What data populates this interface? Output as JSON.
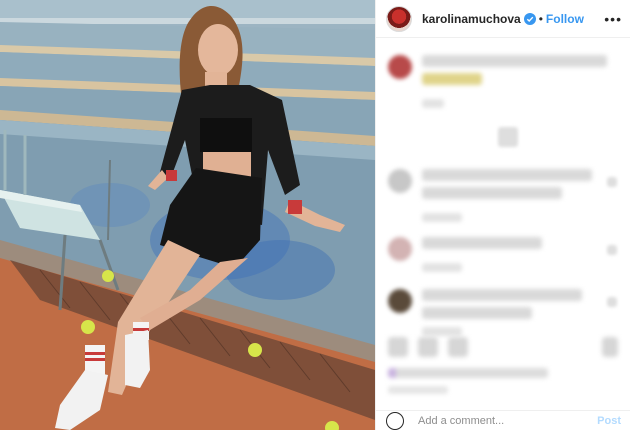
{
  "post": {
    "username": "karolinamuchova",
    "separator": "•",
    "follow_label": "Follow",
    "more_label": "•••",
    "verified_icon": "verified-badge-icon",
    "accent": "#3897f0"
  },
  "comment_box": {
    "placeholder": "Add a comment...",
    "post_label": "Post"
  }
}
